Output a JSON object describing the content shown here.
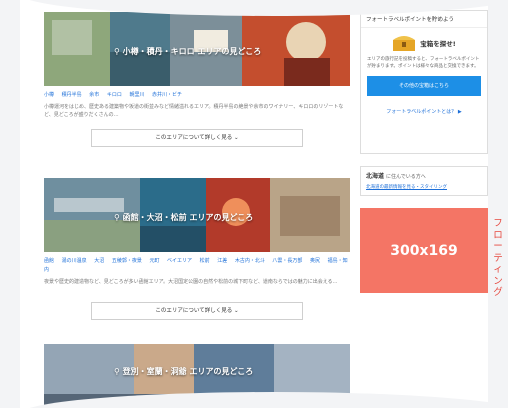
{
  "sections": [
    {
      "caption": "小樽・積丹・キロロ エリアの見どころ",
      "tags": [
        "小樽",
        "積丹半島",
        "余市",
        "キロロ",
        "朝里川",
        "赤井川・ビチ"
      ],
      "desc": "小樽運河をはじめ、歴史ある建築物や坂道の街並みなど情緒溢れるエリア。積丹半島の絶景や余市のワイナリー、キロロのリゾートなど、見どころが盛りだくさんの…",
      "button": "このエリアについて詳しく見る"
    },
    {
      "caption": "函館・大沼・松前 エリアの見どころ",
      "tags": [
        "函館",
        "湯の川温泉",
        "大沼",
        "五稜郭・夜景",
        "元町",
        "ベイエリア",
        "松前",
        "江差",
        "木古内・北斗",
        "八雲・長万部",
        "奥尻",
        "福島・知内"
      ],
      "desc": "夜景や歴史的建造物など、見どころが多い函館エリア。大沼国定公園の自然や松前の城下町など、道南ならではの魅力に出会える…",
      "button": "このエリアについて詳しく見る"
    },
    {
      "caption": "登別・室蘭・洞爺 エリアの見どころ"
    }
  ],
  "sidebar": {
    "points_header": "フォートラベルポイントを貯めよう",
    "points_title": "宝箱を探せ!",
    "points_text": "エリアの旅行記を投稿すると、フォートラベルポイントが貯まります。ポイントは様々な商品と交換できます。",
    "points_button": "その他の宝箱はこちら",
    "points_link": "フォートラベルポイントとは？ ▶",
    "hokkaido_title": "北海道",
    "hokkaido_sub": "に住んでいる方へ",
    "hokkaido_link": "北海道の最新情報を見る・スタイリング"
  },
  "ad": {
    "label": "300x169"
  },
  "floating_label": "フローティング",
  "colors": {
    "accent": "#1d8fe6",
    "ad_bg": "#f47565",
    "floating_text": "#e6483f"
  }
}
